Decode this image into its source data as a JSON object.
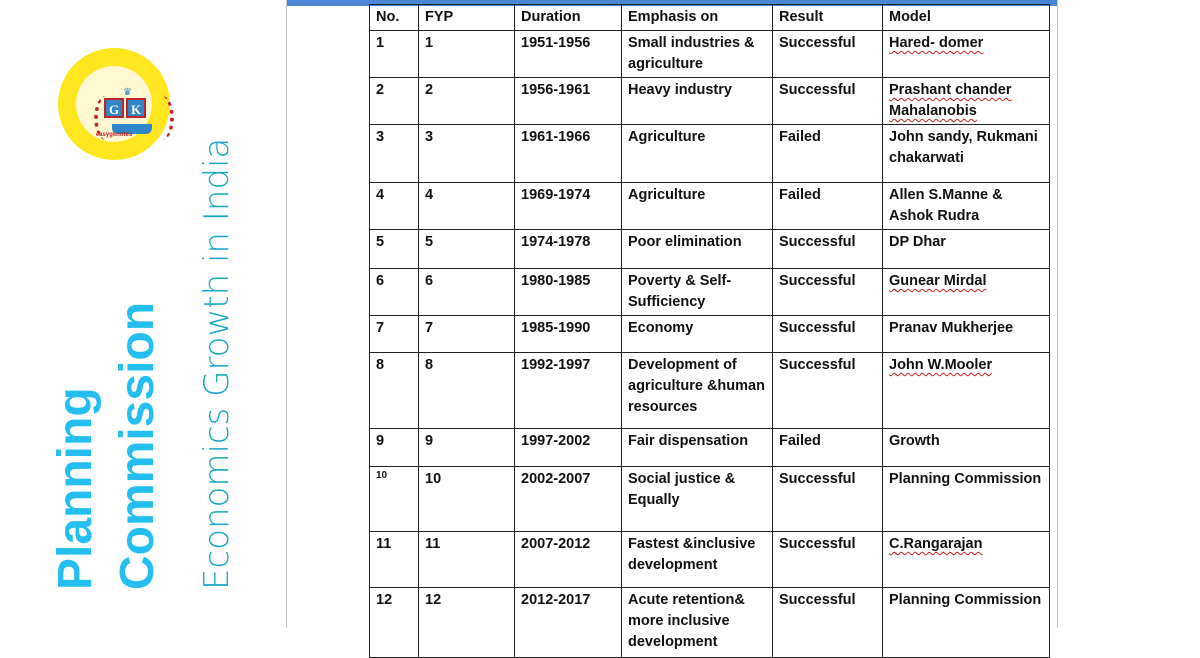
{
  "branding": {
    "logo_letters": [
      "G",
      "K"
    ],
    "logo_caption": "easygknotes",
    "title_line1": "Planning",
    "title_line2": "Commission",
    "subtitle": "Economics Growth in India",
    "colors": {
      "title": "#24bff0",
      "subtitle": "#1aa6c6",
      "logo_bg": "#ffe61f",
      "logo_accent": "#2f86c8",
      "logo_red": "#c2232b"
    }
  },
  "table": {
    "headers": [
      "No.",
      "FYP",
      "Duration",
      "Emphasis on",
      "Result",
      "Model"
    ],
    "rows": [
      {
        "no": "1",
        "fyp": "1",
        "duration": "1951-1956",
        "emphasis": "Small industries & agriculture",
        "result": "Successful",
        "model": "Hared- domer"
      },
      {
        "no": "2",
        "fyp": "2",
        "duration": "1956-1961",
        "emphasis": "Heavy industry",
        "result": "Successful",
        "model": "Prashant chander Mahalanobis"
      },
      {
        "no": "3",
        "fyp": "3",
        "duration": "1961-1966",
        "emphasis": "Agriculture",
        "result": "Failed",
        "model": "John sandy, Rukmani chakarwati"
      },
      {
        "no": "4",
        "fyp": "4",
        "duration": "1969-1974",
        "emphasis": "Agriculture",
        "result": "Failed",
        "model": "Allen  S.Manne & Ashok Rudra"
      },
      {
        "no": "5",
        "fyp": "5",
        "duration": "1974-1978",
        "emphasis": "Poor elimination",
        "result": "Successful",
        "model": "DP Dhar"
      },
      {
        "no": "6",
        "fyp": "6",
        "duration": "1980-1985",
        "emphasis": "Poverty & Self-Sufficiency",
        "result": "Successful",
        "model": "Gunear Mirdal"
      },
      {
        "no": "7",
        "fyp": "7",
        "duration": "1985-1990",
        "emphasis": "Economy",
        "result": "Successful",
        "model": "Pranav Mukherjee"
      },
      {
        "no": "8",
        "fyp": "8",
        "duration": "1992-1997",
        "emphasis": "Development of agriculture &human resources",
        "result": "Successful",
        "model": "John W.Mooler"
      },
      {
        "no": "9",
        "fyp": "9",
        "duration": "1997-2002",
        "emphasis": "Fair dispensation",
        "result": "Failed",
        "model": "Growth"
      },
      {
        "no": "10",
        "fyp": "10",
        "duration": "2002-2007",
        "emphasis": "Social justice & Equally",
        "result": "Successful",
        "model": "Planning Commission"
      },
      {
        "no": "11",
        "fyp": "11",
        "duration": "2007-2012",
        "emphasis": "Fastest &inclusive development",
        "result": "Successful",
        "model": "C.Rangarajan"
      },
      {
        "no": "12",
        "fyp": "12",
        "duration": "2012-2017",
        "emphasis": "Acute retention& more inclusive development",
        "result": "Successful",
        "model": "Planning Commission"
      }
    ]
  }
}
